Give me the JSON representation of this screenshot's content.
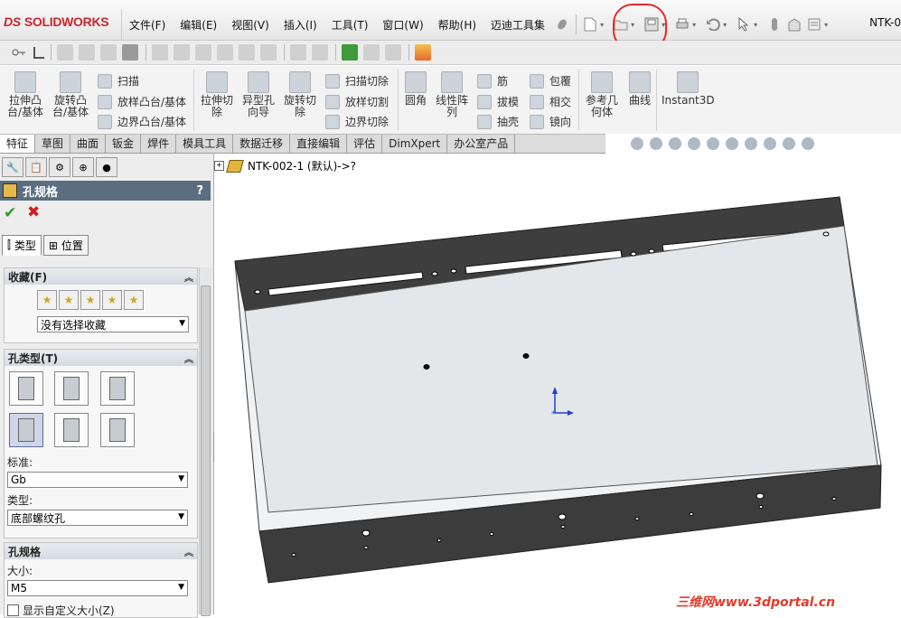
{
  "app": {
    "name": "SOLIDWORKS",
    "brand_color": "#c8262b"
  },
  "menu": [
    "文件(F)",
    "编辑(E)",
    "视图(V)",
    "插入(I)",
    "工具(T)",
    "窗口(W)",
    "帮助(H)",
    "迈迪工具集"
  ],
  "document_title": "NTK-0",
  "command_manager": {
    "big_buttons": [
      {
        "label": "拉伸凸\n台/基体"
      },
      {
        "label": "旋转凸\n台/基体"
      },
      {
        "label": "拉伸切\n除"
      },
      {
        "label": "异型孔\n向导"
      },
      {
        "label": "旋转切\n除"
      },
      {
        "label": "圆角"
      },
      {
        "label": "线性阵\n列"
      },
      {
        "label": "参考几\n何体"
      },
      {
        "label": "曲线"
      },
      {
        "label": "Instant3D"
      }
    ],
    "small_buttons": [
      "扫描",
      "放样凸台/基体",
      "边界凸台/基体",
      "扫描切除",
      "放样切割",
      "边界切除",
      "筋",
      "拔模",
      "抽壳",
      "包覆",
      "相交",
      "镜向"
    ]
  },
  "tabs": [
    "特征",
    "草图",
    "曲面",
    "钣金",
    "焊件",
    "模具工具",
    "数据迁移",
    "直接编辑",
    "评估",
    "DimXpert",
    "办公室产品"
  ],
  "active_tab": "特征",
  "property_manager": {
    "title": "孔规格",
    "help": "?",
    "ok": "✔",
    "cancel": "✖",
    "subtabs": [
      "类型",
      "位置"
    ],
    "favorites": {
      "heading": "收藏(F)",
      "selected": "没有选择收藏"
    },
    "hole_type": {
      "heading": "孔类型(T)",
      "standard_label": "标准:",
      "standard_value": "Gb",
      "type_label": "类型:",
      "type_value": "底部螺纹孔"
    },
    "hole_spec": {
      "heading": "孔规格",
      "size_label": "大小:",
      "size_value": "M5",
      "custom_size": "显示自定义大小(Z)"
    }
  },
  "feature_tree": {
    "node": "NTK-002-1  (默认)->?"
  },
  "watermark": "三维网www.3dportal.cn",
  "colors": {
    "panel_header": "#5b6e80",
    "model_dark": "#3d3d3d",
    "model_face": "#e4e7ea",
    "annotation_red": "#e52a2a",
    "axis_blue": "#1f3fd6"
  }
}
